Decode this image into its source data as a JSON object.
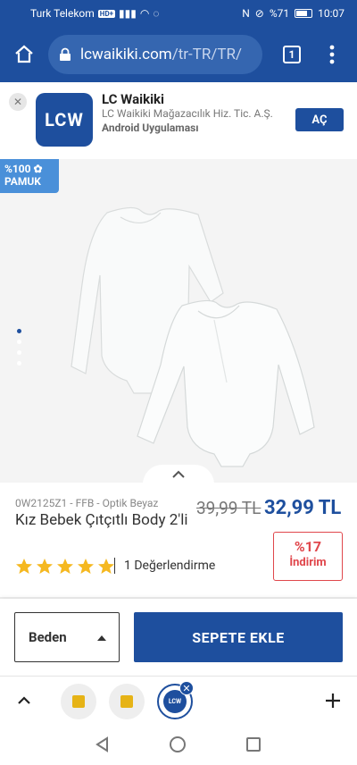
{
  "status": {
    "carrier": "Turk Telekom",
    "network_badge": "HD+",
    "battery": "%71",
    "time": "10:07"
  },
  "browser": {
    "url_host": "lcwaikiki.com",
    "url_path": "/tr-TR/TR/",
    "tab_count": "1"
  },
  "app_banner": {
    "app_name": "LC Waikiki",
    "company": "LC Waikiki Mağazacılık Hiz. Tic. A.Ş.",
    "type": "Android Uygulaması",
    "open_label": "AÇ",
    "icon_text": "LCW"
  },
  "product": {
    "badge_line1": "%100",
    "badge_line2": "PAMUK",
    "sku": "0W2125Z1 - FFB - Optik Beyaz",
    "title": "Kız Bebek Çıtçıtlı Body 2'li",
    "old_price": "39,99 TL",
    "new_price": "32,99 TL",
    "rating_stars": 5,
    "rating_text": "1 Değerlendirme",
    "discount_pct": "%17",
    "discount_label": "İndirim",
    "image_dots": 4,
    "active_dot": 0
  },
  "cart": {
    "size_label": "Beden",
    "add_to_cart": "SEPETE EKLE"
  },
  "bottom_tabs": {
    "active_tab_text": "LCW"
  },
  "colors": {
    "brand": "#1e4f9e",
    "discount": "#e0474c",
    "star": "#f5b820"
  }
}
